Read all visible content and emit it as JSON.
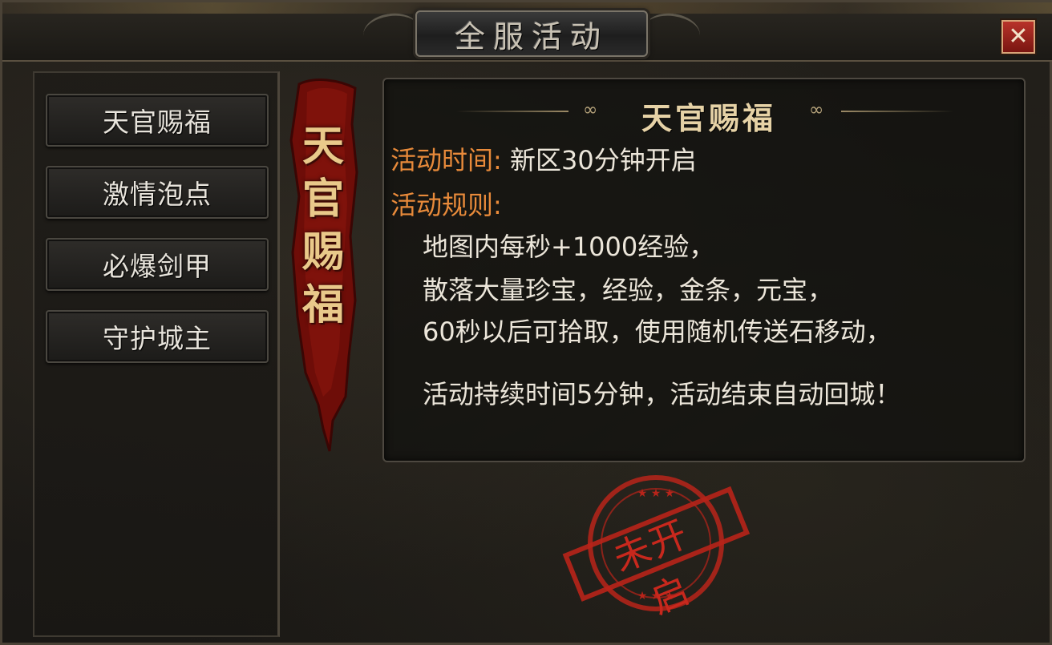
{
  "window": {
    "title": "全服活动",
    "close_label": "✕"
  },
  "sidebar": {
    "items": [
      {
        "label": "天官赐福"
      },
      {
        "label": "激情泡点"
      },
      {
        "label": "必爆剑甲"
      },
      {
        "label": "守护城主"
      }
    ]
  },
  "banner": {
    "text": "天官赐福"
  },
  "detail": {
    "heading": "天官赐福",
    "time_label": "活动时间:",
    "time_value": "新区30分钟开启",
    "rules_label": "活动规则:",
    "rules": [
      "地图内每秒+1000经验，",
      "散落大量珍宝，经验，金条，元宝，",
      "60秒以后可拾取，使用随机传送石移动，",
      "活动持续时间5分钟，活动结束自动回城！"
    ]
  },
  "stamp": {
    "text": "未开启"
  },
  "colors": {
    "accent_orange": "#e88a3a",
    "stamp_red": "#c8281d",
    "banner_red": "#7a0f0a",
    "gold": "#e6d2a6"
  }
}
